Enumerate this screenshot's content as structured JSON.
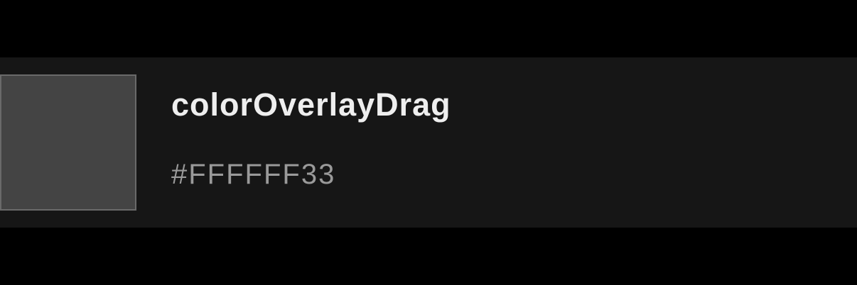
{
  "color_token": {
    "name": "colorOverlayDrag",
    "value": "#FFFFFF33",
    "swatch_fill": "#444444",
    "swatch_border": "#6a6a6a"
  },
  "colors": {
    "page_background": "#000000",
    "row_background": "#161616",
    "name_text": "#eeeeee",
    "value_text": "#9a9a9a"
  }
}
